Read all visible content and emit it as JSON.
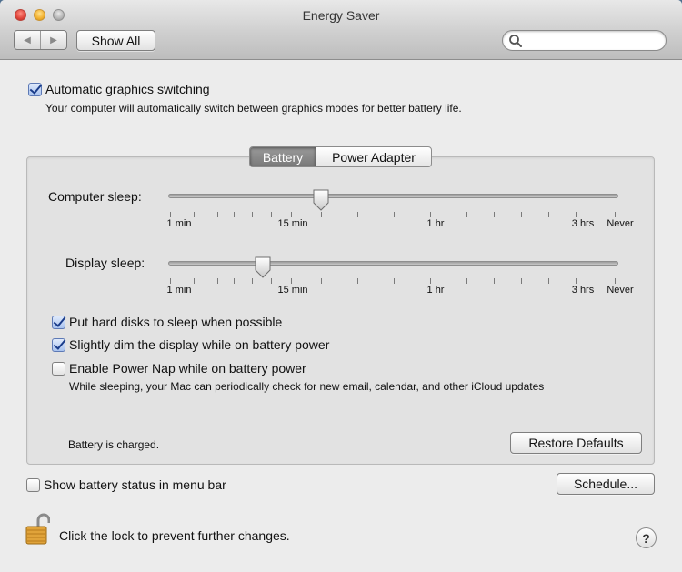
{
  "window": {
    "title": "Energy Saver"
  },
  "toolbar": {
    "back_icon": "back-arrow",
    "forward_icon": "forward-arrow",
    "show_all_label": "Show All",
    "search_placeholder": "",
    "search_value": ""
  },
  "graphics": {
    "checked": true,
    "label": "Automatic graphics switching",
    "description": "Your computer will automatically switch between graphics modes for better battery life."
  },
  "tabs": [
    {
      "label": "Battery",
      "active": true
    },
    {
      "label": "Power Adapter",
      "active": false
    }
  ],
  "sliders": {
    "computer_sleep": {
      "label": "Computer sleep:",
      "value": "15 min",
      "tick_labels": [
        "1 min",
        "15 min",
        "1 hr",
        "3 hrs",
        "Never"
      ]
    },
    "display_sleep": {
      "label": "Display sleep:",
      "value": "5 min",
      "tick_labels": [
        "1 min",
        "15 min",
        "1 hr",
        "3 hrs",
        "Never"
      ]
    }
  },
  "options": [
    {
      "label": "Put hard disks to sleep when possible",
      "checked": true
    },
    {
      "label": "Slightly dim the display while on battery power",
      "checked": true
    },
    {
      "label": "Enable Power Nap while on battery power",
      "checked": false,
      "description": "While sleeping, your Mac can periodically check for new email, calendar, and other iCloud updates"
    }
  ],
  "battery_status": "Battery is charged.",
  "restore_defaults_label": "Restore Defaults",
  "menu_bar_option": {
    "label": "Show battery status in menu bar",
    "checked": false
  },
  "schedule_label": "Schedule...",
  "lock_text": "Click the lock to prevent further changes.",
  "help_label": "?"
}
